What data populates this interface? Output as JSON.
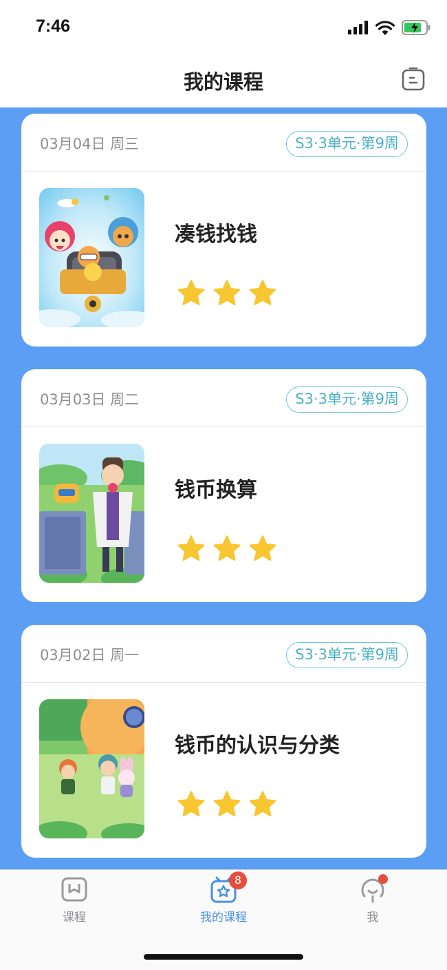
{
  "status_bar": {
    "time": "7:46"
  },
  "nav": {
    "title": "我的课程",
    "right_icon": "schedule-icon"
  },
  "courses": [
    {
      "date": "03月04日  周三",
      "tag": "S3·3单元·第9周",
      "title": "凑钱找钱",
      "stars": 3,
      "thumbnail": "illustration-motorbike"
    },
    {
      "date": "03月03日  周二",
      "tag": "S3·3单元·第9周",
      "title": "钱币换算",
      "stars": 3,
      "thumbnail": "illustration-professor"
    },
    {
      "date": "03月02日  周一",
      "tag": "S3·3单元·第9周",
      "title": "钱币的认识与分类",
      "stars": 3,
      "thumbnail": "illustration-friends"
    }
  ],
  "tabs": [
    {
      "label": "课程",
      "icon": "course-icon",
      "active": false
    },
    {
      "label": "我的课程",
      "icon": "my-course-icon",
      "active": true,
      "badge": "8"
    },
    {
      "label": "我",
      "icon": "profile-icon",
      "active": false,
      "dot": true
    }
  ],
  "colors": {
    "background": "#5b9ef3",
    "tag": "#4db0c6",
    "star": "#f8c630",
    "active_tab": "#4a90e2",
    "badge": "#e74c3c"
  }
}
